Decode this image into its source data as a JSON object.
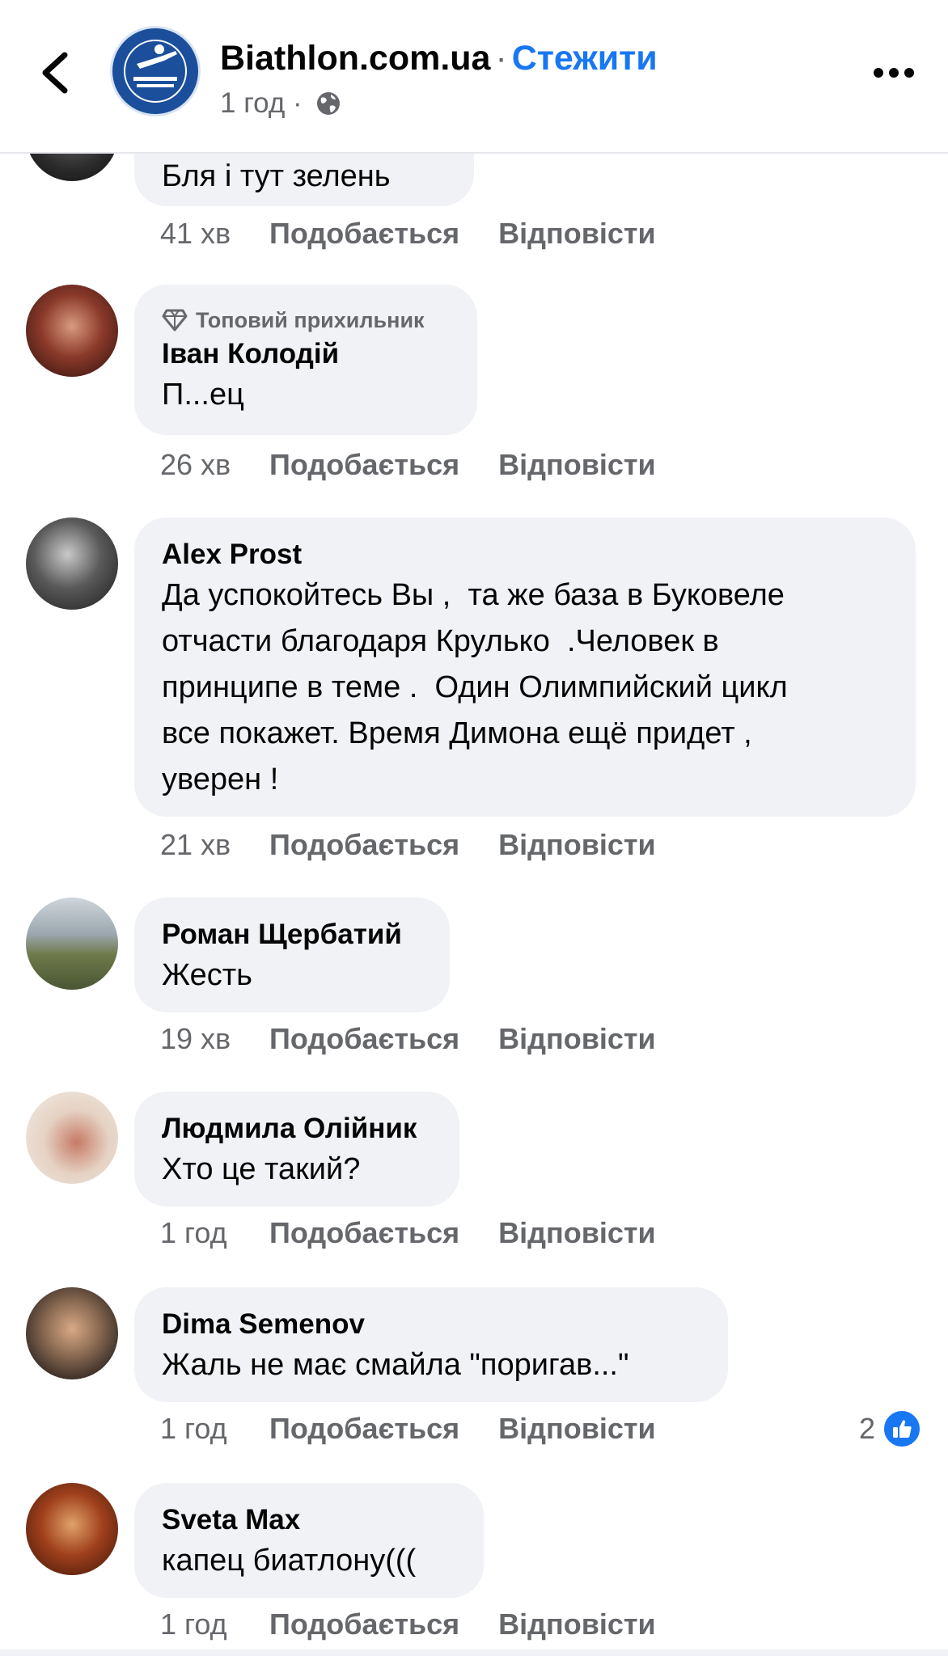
{
  "header": {
    "page_name": "Biathlon.com.ua",
    "separator": "·",
    "follow_label": "Стежити",
    "time": "1 год",
    "time_separator": "·",
    "logo_icon": "ukrainian-biathlon-logo",
    "back_icon": "chevron-left-icon",
    "more_icon": "more-dots-icon",
    "accent_color": "#1877f2"
  },
  "actions": {
    "like": "Подобається",
    "reply": "Відповісти"
  },
  "comments": [
    {
      "author": "",
      "text": "Бля і тут зелень",
      "time": "41 хв"
    },
    {
      "badge": "Топовий прихильник",
      "author": "Іван Колодій",
      "text": "П...ец",
      "time": "26 хв"
    },
    {
      "author": "Alex  Prost",
      "text": "Да успокойтесь Вы ,  та же база в Буковеле\nотчасти благодаря Крулько  .Человек в\nпринципе в теме .  Один Олимпийский цикл\nвсе покажет. Время Димона ещё придет ,\nуверен !",
      "time": "21 хв"
    },
    {
      "author": "Роман Щербатий",
      "text": "Жесть",
      "time": "19 хв"
    },
    {
      "author": "Людмила Олійник",
      "text": "Хто це такий?",
      "time": "1 год"
    },
    {
      "author": "Dima Semenov",
      "text": "Жаль не має смайла \"поригав...\"",
      "time": "1 год",
      "reaction_count": "2"
    },
    {
      "author": "Sveta Max",
      "text": "капец биатлону(((",
      "time": "1 год"
    }
  ]
}
